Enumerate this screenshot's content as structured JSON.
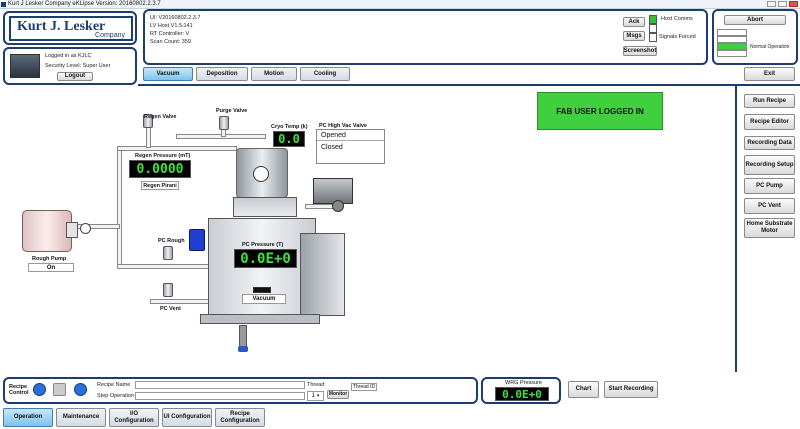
{
  "window": {
    "title": "Kurt J Lesker Company eKLipse Version: 20160802.2.3.7"
  },
  "logo": {
    "name": "Kurt J. Lesker",
    "sub": "Company"
  },
  "user": {
    "logged_in": "Logged in as KJLC",
    "security": "Security Level: Super User",
    "logout_label": "Logout"
  },
  "info": {
    "lines": [
      "UI: V20160802.2.3.7",
      "LV Host V1.5.141",
      "RT Controller: V",
      "Scan Count: 359"
    ],
    "ack_label": "Ack",
    "msgs_label": "Msgs",
    "screenshot_label": "Screenshot",
    "host_comms": "Host Comms",
    "signals_forced": "Signals Forced"
  },
  "status": {
    "abort_label": "Abort",
    "mode": "Normal Operation"
  },
  "tabs": [
    "Vacuum",
    "Deposition",
    "Motion",
    "Cooling"
  ],
  "banner": "FAB USER LOGGED IN",
  "side": {
    "exit": "Exit",
    "buttons": [
      "Run Recipe",
      "Recipe Editor",
      "Recording Data",
      "Recording Setup",
      "PC Pump",
      "PC Vent",
      "Home Substrate Motor"
    ]
  },
  "diagram": {
    "regen_valve": "Regen Valve",
    "purge_valve": "Purge Valve",
    "cryo_temp_label": "Cryo Temp (k)",
    "cryo_temp": "0.0",
    "regen_pressure_label": "Regen Pressure (mT)",
    "regen_pressure": "0.0000",
    "regen_pirani": "Regen Pirani",
    "pc_hivac_label": "PC High Vac Valve",
    "pc_hivac_opened": "Opened",
    "pc_hivac_closed": "Closed",
    "pc_rough": "PC Rough",
    "pc_pressure_label": "PC Pressure (T)",
    "pc_pressure": "0.0E+0",
    "vacuum_label": "Vacuum",
    "pc_vent": "PC Vent",
    "rough_pump": "Rough Pump",
    "rough_pump_state": "On"
  },
  "recipe": {
    "label": "Recipe Control",
    "recipe_name": "Recipe Name",
    "step_operation": "Step Operation",
    "thread": "Thread",
    "thread_value": "1",
    "thread_id": "Thread ID",
    "monitor": "Monitor"
  },
  "wrg": {
    "label": "WRG Pressure",
    "value": "0.0E+0"
  },
  "chart_label": "Chart",
  "start_recording": "Start Recording",
  "bottom_tabs": [
    "Operation",
    "Maintenance",
    "I/O Configuration",
    "UI Configuration",
    "Recipe Configuration"
  ]
}
